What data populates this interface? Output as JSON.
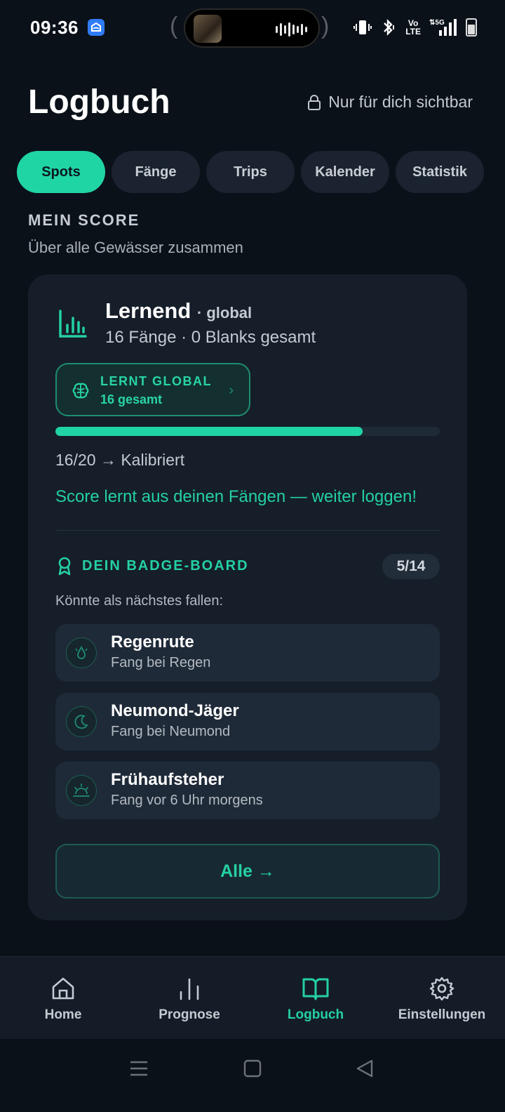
{
  "status_bar": {
    "time": "09:36",
    "network_label": "5G",
    "volte_label": "Vo\nLTE"
  },
  "header": {
    "title": "Logbuch",
    "privacy_label": "Nur für dich sichtbar"
  },
  "tabs": [
    {
      "label": "Spots",
      "active": true
    },
    {
      "label": "Fänge",
      "active": false
    },
    {
      "label": "Trips",
      "active": false
    },
    {
      "label": "Kalender",
      "active": false
    },
    {
      "label": "Statistik",
      "active": false
    }
  ],
  "score_section": {
    "title": "MEIN SCORE",
    "subtitle": "Über alle Gewässer zusammen"
  },
  "score_card": {
    "name": "Lernend",
    "scope": "· global",
    "meta": "16 Fänge · 0 Blanks gesamt",
    "learn_title": "LERNT GLOBAL",
    "learn_sub": "16 gesamt",
    "progress_fraction": 0.8,
    "progress_label": "16/20 → Kalibriert",
    "hint": "Score lernt aus deinen Fängen — weiter loggen!"
  },
  "badge_board": {
    "title": "DEIN BADGE-BOARD",
    "count": "5/14",
    "next_label": "Könnte als nächstes fallen:",
    "items": [
      {
        "name": "Regenrute",
        "desc": "Fang bei Regen",
        "icon": "raindrop-icon"
      },
      {
        "name": "Neumond-Jäger",
        "desc": "Fang bei Neumond",
        "icon": "moon-icon"
      },
      {
        "name": "Frühaufsteher",
        "desc": "Fang vor 6 Uhr morgens",
        "icon": "sunrise-icon"
      }
    ],
    "all_button": "Alle →"
  },
  "bottom_nav": [
    {
      "label": "Home",
      "icon": "home-icon",
      "active": false
    },
    {
      "label": "Prognose",
      "icon": "bar-chart-icon",
      "active": false
    },
    {
      "label": "Logbuch",
      "icon": "book-icon",
      "active": true
    },
    {
      "label": "Einstellungen",
      "icon": "gear-icon",
      "active": false
    }
  ],
  "colors": {
    "accent": "#20d5a4",
    "background": "#0b1119",
    "card": "#151e29"
  }
}
